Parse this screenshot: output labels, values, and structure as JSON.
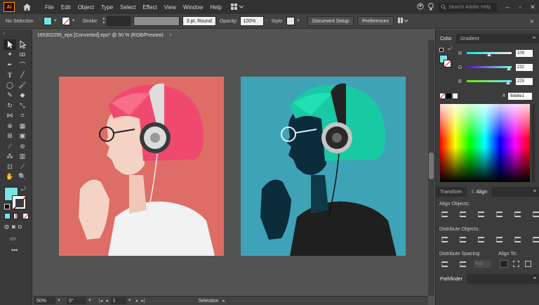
{
  "app": {
    "logo": "Ai",
    "menu": [
      "File",
      "Edit",
      "Object",
      "Type",
      "Select",
      "Effect",
      "View",
      "Window",
      "Help"
    ],
    "search_placeholder": "Search Adobe Help"
  },
  "control_bar": {
    "selection_label": "No Selection",
    "fill_color": "#77e3e3",
    "stroke_label": "Stroke:",
    "brush_label": "3 pt. Round",
    "opacity_label": "Opacity:",
    "opacity_value": "100%",
    "style_label": "Style:",
    "document_setup_label": "Document Setup",
    "preferences_label": "Preferences"
  },
  "document_tab": {
    "title": "165302255_eps [Converted].eps* @ 50 % (RGB/Preview)",
    "close": "×"
  },
  "status_bar": {
    "zoom": "50%",
    "rotation": "0°",
    "artboard": "1",
    "mode": "Selection"
  },
  "color_panel": {
    "tabs": [
      "Color",
      "Gradient"
    ],
    "r_label": "R",
    "g_label": "G",
    "b_label": "B",
    "r_value": "109",
    "g_value": "232",
    "b_value": "225",
    "hex_prefix": "#",
    "hex_value": "6de8e1"
  },
  "align_panel": {
    "tabs": [
      "Transform",
      "Align"
    ],
    "align_objects": "Align Objects:",
    "distribute_objects": "Distribute Objects:",
    "distribute_spacing": "Distribute Spacing:",
    "align_to": "Align To:",
    "spacing_value": "0 pt"
  },
  "pathfinder_panel": {
    "tab": "Pathfinder"
  }
}
